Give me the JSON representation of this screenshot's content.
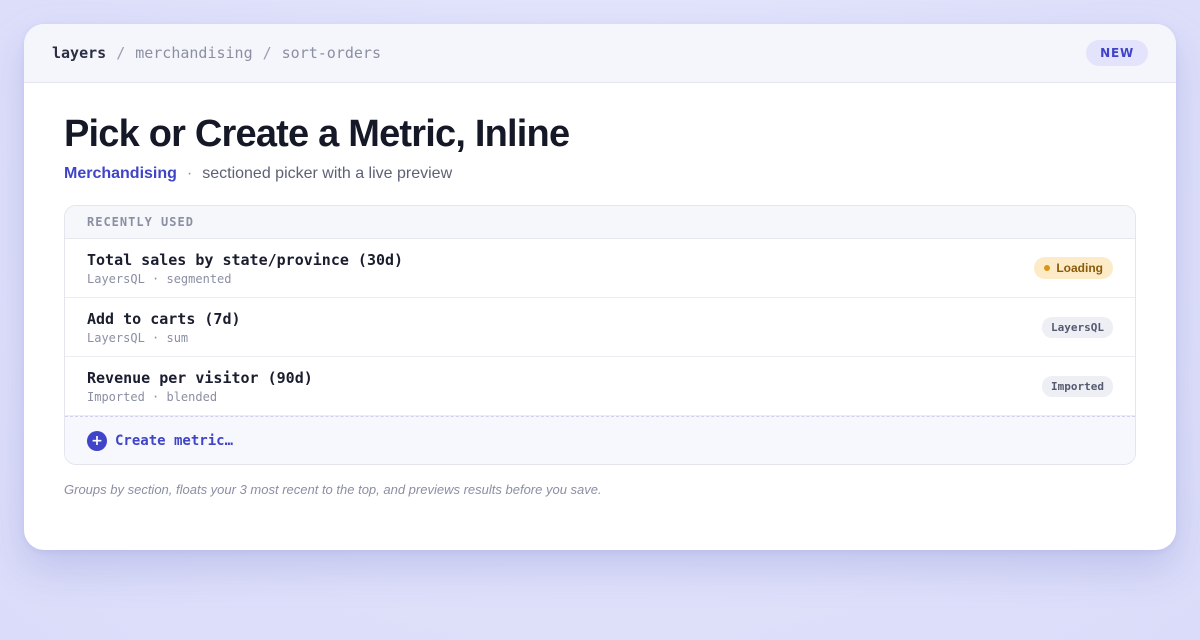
{
  "breadcrumb": {
    "root": "layers",
    "separator": "/",
    "items": [
      "merchandising",
      "sort-orders"
    ]
  },
  "header": {
    "badge": "NEW"
  },
  "main": {
    "title": "Pick or Create a Metric, Inline",
    "subtitle_accent": "Merchandising",
    "subtitle_dot": "·",
    "subtitle_text": "sectioned picker with a live preview"
  },
  "picker": {
    "section_label": "RECENTLY USED",
    "rows": [
      {
        "name": "Total sales by state/province (30d)",
        "meta": "LayersQL · segmented",
        "badge": "Loading",
        "badge_type": "loading"
      },
      {
        "name": "Add to carts (7d)",
        "meta": "LayersQL · sum",
        "badge": "LayersQL",
        "badge_type": "tag"
      },
      {
        "name": "Revenue per visitor (90d)",
        "meta": "Imported · blended",
        "badge": "Imported",
        "badge_type": "tag"
      }
    ],
    "create_label": "Create metric…",
    "create_icon": "plus-icon"
  },
  "footnote": "Groups by section, floats your 3 most recent to the top, and previews results before you save.",
  "colors": {
    "accent": "#3f44c8",
    "loading_bg": "#fdebc8",
    "loading_text": "#8a5a08"
  }
}
